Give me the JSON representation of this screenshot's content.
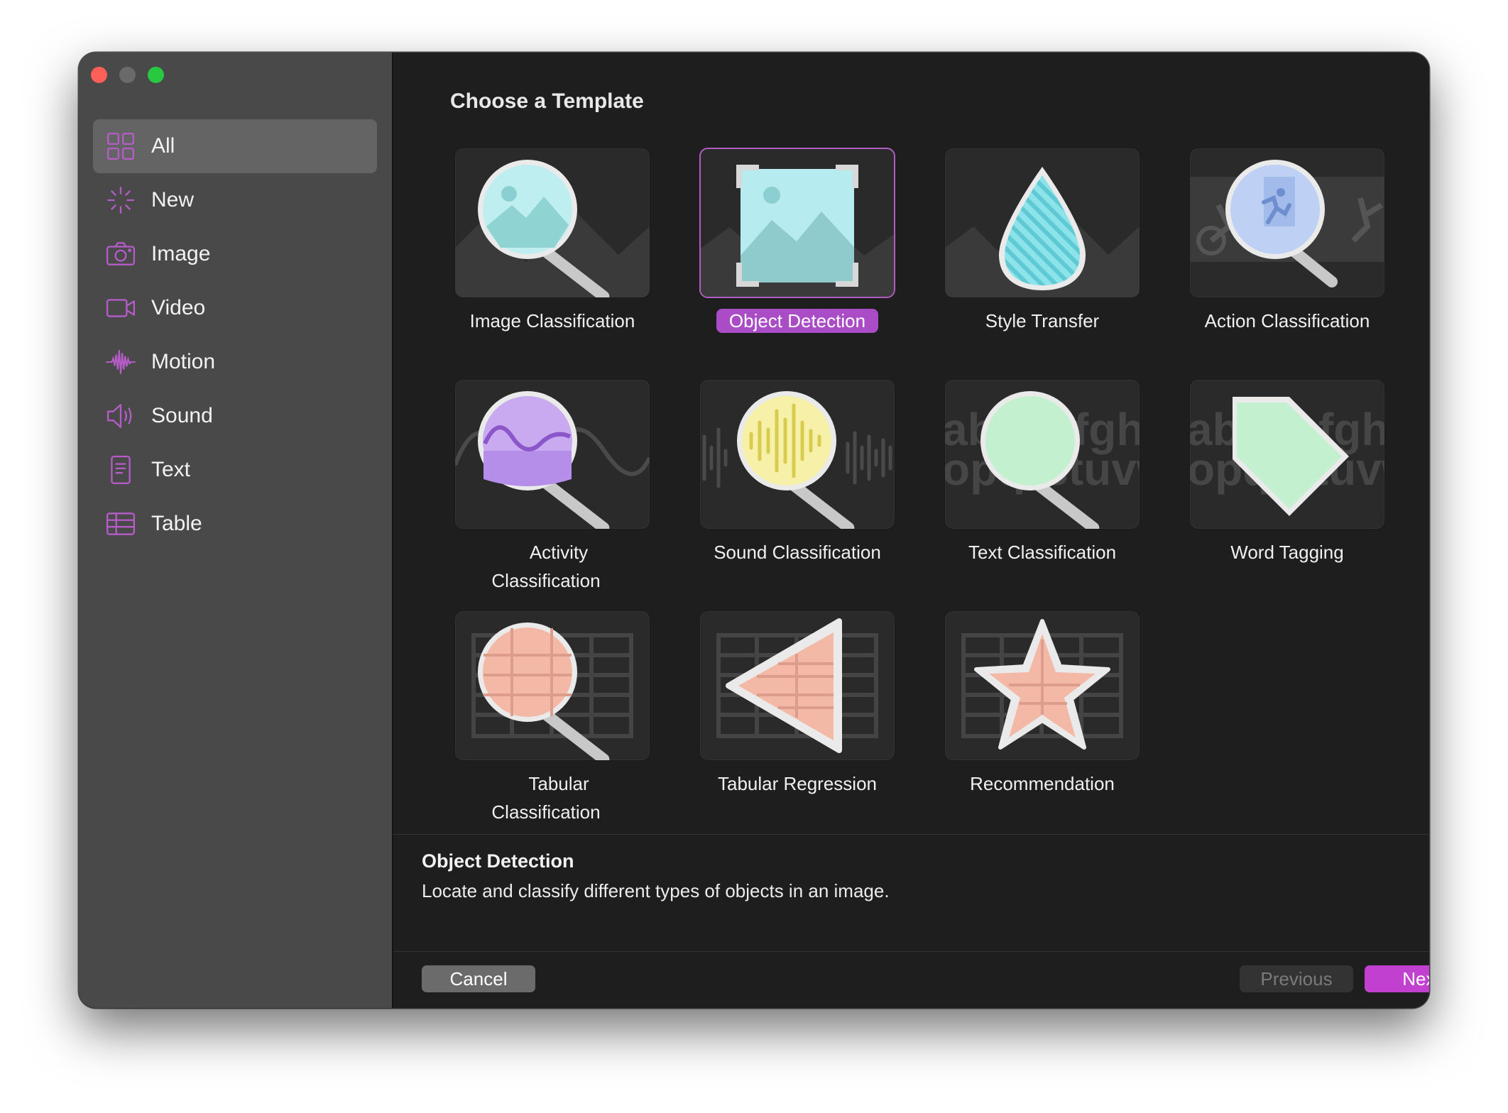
{
  "window": {
    "traffic_lights": [
      "close",
      "minimize",
      "zoom"
    ]
  },
  "sidebar": {
    "items": [
      {
        "label": "All",
        "icon": "grid-icon",
        "selected": true
      },
      {
        "label": "New",
        "icon": "sparkle-icon"
      },
      {
        "label": "Image",
        "icon": "camera-icon"
      },
      {
        "label": "Video",
        "icon": "video-camera-icon"
      },
      {
        "label": "Motion",
        "icon": "waveform-icon"
      },
      {
        "label": "Sound",
        "icon": "speaker-icon"
      },
      {
        "label": "Text",
        "icon": "document-icon"
      },
      {
        "label": "Table",
        "icon": "table-icon"
      }
    ]
  },
  "main": {
    "title": "Choose a Template",
    "templates": [
      {
        "label": "Image Classification",
        "icon": "magnifier-image-icon"
      },
      {
        "label": "Object Detection",
        "icon": "framed-image-icon",
        "selected": true
      },
      {
        "label": "Style Transfer",
        "icon": "droplet-icon"
      },
      {
        "label": "Action Classification",
        "icon": "magnifier-running-person-icon"
      },
      {
        "label": "Activity Classification",
        "icon": "magnifier-wave-icon"
      },
      {
        "label": "Sound Classification",
        "icon": "magnifier-audio-icon"
      },
      {
        "label": "Text Classification",
        "icon": "magnifier-text-icon"
      },
      {
        "label": "Word Tagging",
        "icon": "tag-text-icon"
      },
      {
        "label": "Tabular Classification",
        "icon": "magnifier-table-icon"
      },
      {
        "label": "Tabular Regression",
        "icon": "triangle-table-icon"
      },
      {
        "label": "Recommendation",
        "icon": "star-table-icon"
      }
    ],
    "thumb_text": {
      "line1": "abcdefghi",
      "line2": "opqrstuvw"
    }
  },
  "description": {
    "title": "Object Detection",
    "text": "Locate and classify different types of objects in an image."
  },
  "buttons": {
    "cancel": "Cancel",
    "previous": "Previous",
    "next": "Next"
  },
  "colors": {
    "accent": "#c240cf",
    "selection_label": "#a94cc6",
    "sidebar_icon": "#b65cc9"
  }
}
